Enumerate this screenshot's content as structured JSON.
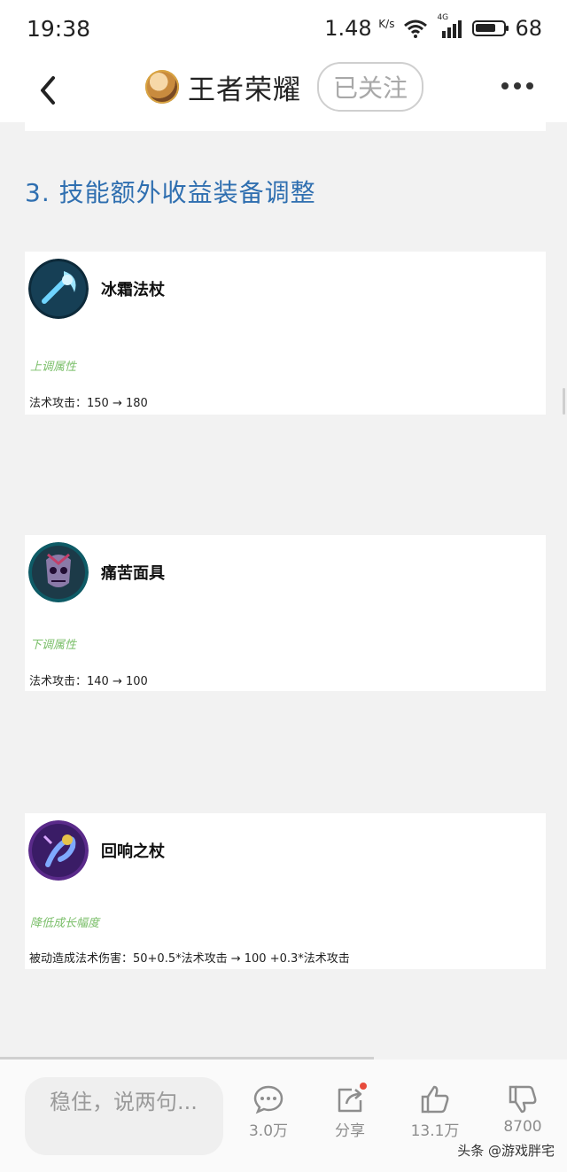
{
  "status_bar": {
    "time": "19:38",
    "speed": "1.48",
    "speed_unit": "K/s",
    "network": "4G",
    "battery": "68"
  },
  "nav": {
    "title": "王者荣耀",
    "follow_label": "已关注"
  },
  "article": {
    "section_title": "3. 技能额外收益装备调整",
    "items": [
      {
        "name": "冰霜法杖",
        "attr_label": "上调属性",
        "change": "法术攻击：150  → 180",
        "icon": "frost-staff-icon"
      },
      {
        "name": "痛苦面具",
        "attr_label": "下调属性",
        "change": "法术攻击：140 → 100",
        "icon": "mask-of-agony-icon"
      },
      {
        "name": "回响之杖",
        "attr_label": "降低成长幅度",
        "change": "被动造成法术伤害：50+0.5*法术攻击 → 100 +0.3*法术攻击",
        "icon": "echo-staff-icon"
      }
    ]
  },
  "bottom_bar": {
    "input_placeholder": "稳住，说两句...",
    "comments_count": "3.0万",
    "share_label": "分享",
    "likes_count": "13.1万",
    "dislikes_count": "8700",
    "watermark": "头条 @游戏胖宅"
  },
  "colors": {
    "section_title": "#2f6fb0",
    "attr_label": "#7bbf6a",
    "share_dot": "#e74b3c"
  }
}
